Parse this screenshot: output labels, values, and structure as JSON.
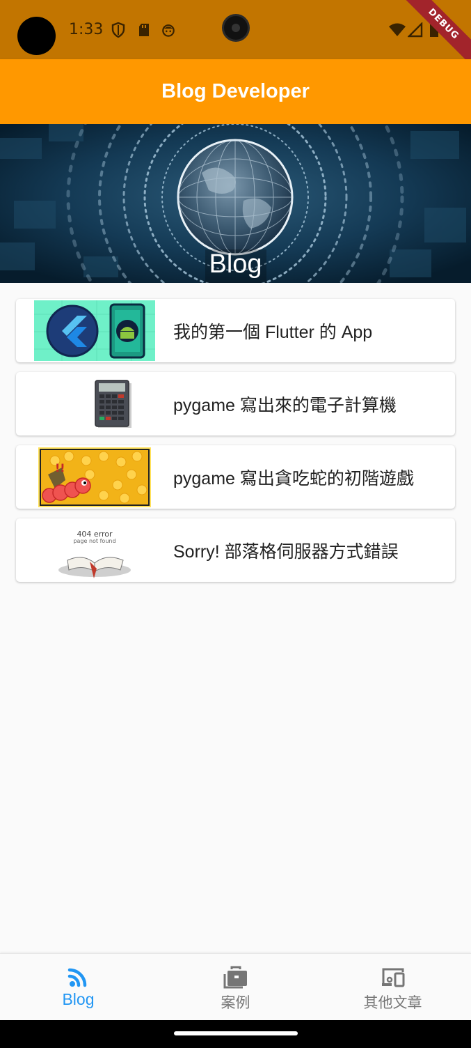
{
  "status_bar": {
    "time": "1:33",
    "debug_label": "DEBUG",
    "icons": [
      "shield-icon",
      "sd-card-icon",
      "face-icon",
      "wifi-icon",
      "signal-icon",
      "battery-icon"
    ]
  },
  "app_bar": {
    "title": "Blog Developer"
  },
  "banner": {
    "label": "Blog"
  },
  "articles": [
    {
      "title": "我的第一個 Flutter 的 App",
      "thumb_icon": "flutter-android-icon"
    },
    {
      "title": "pygame 寫出來的電子計算機",
      "thumb_icon": "calculator-icon"
    },
    {
      "title": "pygame 寫出貪吃蛇的初階遊戲",
      "thumb_icon": "snake-game-icon"
    },
    {
      "title": "Sorry! 部落格伺服器方式錯誤",
      "thumb_icon": "404-book-icon"
    }
  ],
  "thumb_text": {
    "error_404": "404 error",
    "not_found": "page not found"
  },
  "bottom_nav": {
    "items": [
      {
        "label": "Blog",
        "icon": "rss-icon",
        "active": true
      },
      {
        "label": "案例",
        "icon": "briefcase-icon",
        "active": false
      },
      {
        "label": "其他文章",
        "icon": "devices-icon",
        "active": false
      }
    ]
  },
  "colors": {
    "status_bar": "#c27500",
    "app_bar": "#ff9800",
    "active_nav": "#2196f3",
    "inactive_nav": "#757575"
  }
}
